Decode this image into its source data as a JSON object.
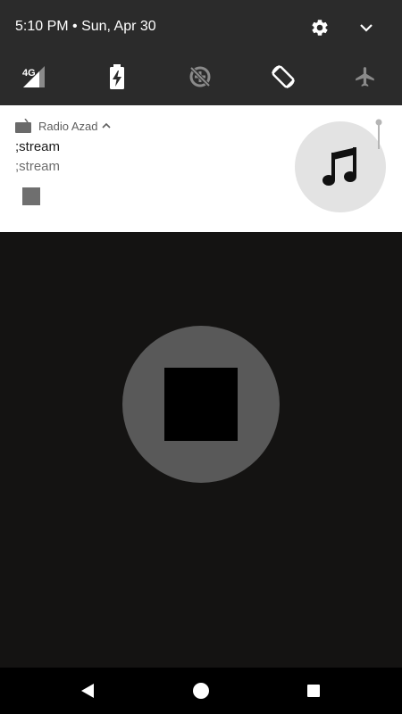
{
  "status_bar": {
    "datetime": "5:10 PM • Sun, Apr 30"
  },
  "quick_settings": {
    "signal_label": "4G",
    "icons": [
      "signal-4g-icon",
      "battery-charging-icon",
      "data-saver-icon",
      "auto-rotate-icon",
      "airplane-mode-icon"
    ]
  },
  "notification": {
    "app_name": "Radio Azad",
    "title": ";stream",
    "text": ";stream",
    "large_icon": "music-note-icon",
    "action_icon": "stop-icon"
  },
  "player": {
    "main_control_icon": "stop-icon"
  },
  "colors": {
    "shade_bg": "#2b2b2b",
    "app_bg": "#141312",
    "stop_circle": "#595959",
    "notification_bg": "#ffffff"
  }
}
